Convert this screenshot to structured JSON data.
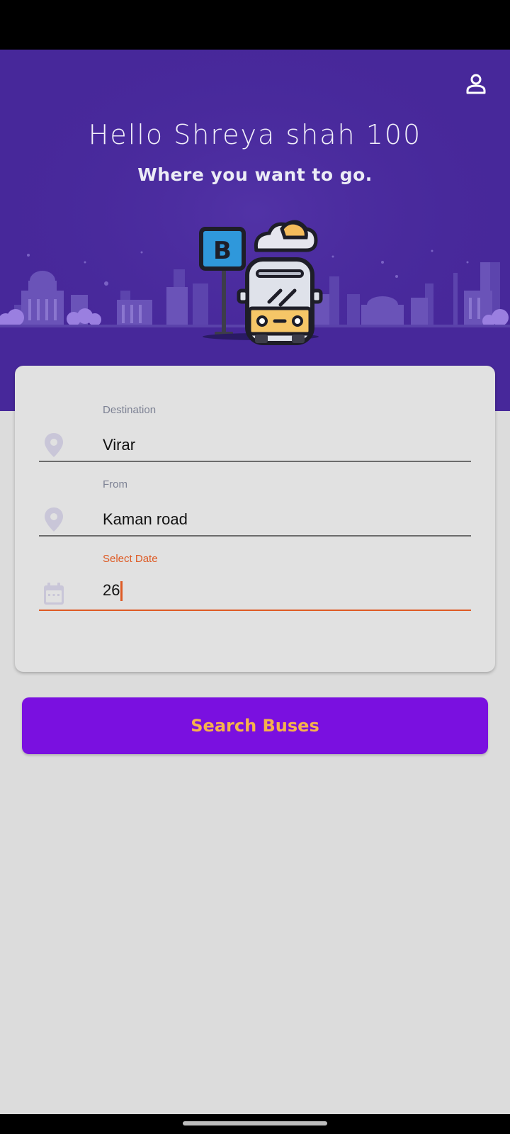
{
  "header": {
    "greeting": "Hello Shreya shah 100",
    "subtitle": "Where you want to go.",
    "profile_icon": "person-outline-icon",
    "bus_stop_sign": "B"
  },
  "form": {
    "destination": {
      "label": "Destination",
      "value": "Virar",
      "icon": "location-pin-icon"
    },
    "from": {
      "label": "From",
      "value": "Kaman road",
      "icon": "location-pin-icon"
    },
    "date": {
      "label": "Select Date",
      "value": "26",
      "icon": "calendar-icon"
    }
  },
  "actions": {
    "search_label": "Search Buses"
  },
  "colors": {
    "hero_bg": "#47289a",
    "accent": "#de5a24",
    "button_bg": "#7a10e0",
    "button_text": "#f6b24c"
  }
}
